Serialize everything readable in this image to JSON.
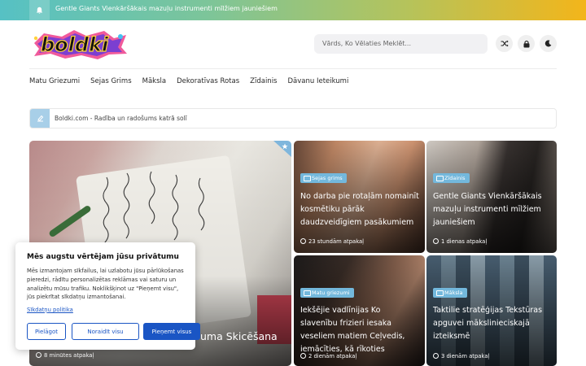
{
  "topbar": {
    "ticker_text": "Gentle Giants Vienkāršākais mazuļu instrumenti mīlžiem jauniešiem"
  },
  "header": {
    "logo_text": "boldki",
    "search_placeholder": "Vārds, Ko Vēlaties Meklēt..."
  },
  "nav": {
    "items": [
      "Matu Griezumi",
      "Sejas Grims",
      "Māksla",
      "Dekoratīvas Rotas",
      "Zīdainis",
      "Dāvanu Ieteikumi"
    ]
  },
  "breadcrumb": {
    "text": "Boldki.com - Radība un radošums katrā solī"
  },
  "cards": [
    {
      "title": "uma Skicēšana",
      "meta": "8 minūtes atpakaļ"
    },
    {
      "category": "Sejas grims",
      "title": "No darba pie rotaļām nomainīt kosmētiku pārāk daudzveidīgiem pasākumiem",
      "meta": "23 stundām atpakaļ"
    },
    {
      "category": "Zīdainis",
      "title": "Gentle Giants Vienkāršākais mazuļu instrumenti mīlžiem jauniešiem",
      "meta": "1 dienas atpakaļ"
    },
    {
      "category": "Matu griezumi",
      "title": "Iekšējie vadlīnijas Ko slavenību frizieri iesaka veseliem matiem Ceļvedis, iemācīties, kā rīkoties",
      "meta": "2 dienām atpakaļ"
    },
    {
      "category": "Māksla",
      "title": "Taktilie stratēģijas Tekstūras apguvei mākslinieciskajā izteiksmē",
      "meta": "3 dienām atpakaļ"
    }
  ],
  "consent": {
    "title": "Mēs augstu vērtējam jūsu privātumu",
    "body": "Mēs izmantojam sīkfailus, lai uzlabotu jūsu pārlūkošanas pieredzi, rādītu personalizētas reklāmas vai saturu un analizētu mūsu trafiku. Noklikšķinot uz \"Pieņemt visu\", jūs piekrītat sīkdatņu izmantošanai.",
    "policy_link": "Sīkdatņu politika",
    "btn_customize": "Pielāgot",
    "btn_reject": "Noraidīt visu",
    "btn_accept": "Pieņemt visus"
  },
  "colors": {
    "accent": "#1a55c4",
    "category_badge": "#73b8dc",
    "topbar_start": "#56c1c4",
    "topbar_end": "#f3b51a"
  },
  "icons": [
    "bell-icon",
    "search-icon",
    "shuffle-icon",
    "lock-icon",
    "moon-icon",
    "breadcrumb-icon",
    "folder-icon",
    "clock-icon"
  ]
}
